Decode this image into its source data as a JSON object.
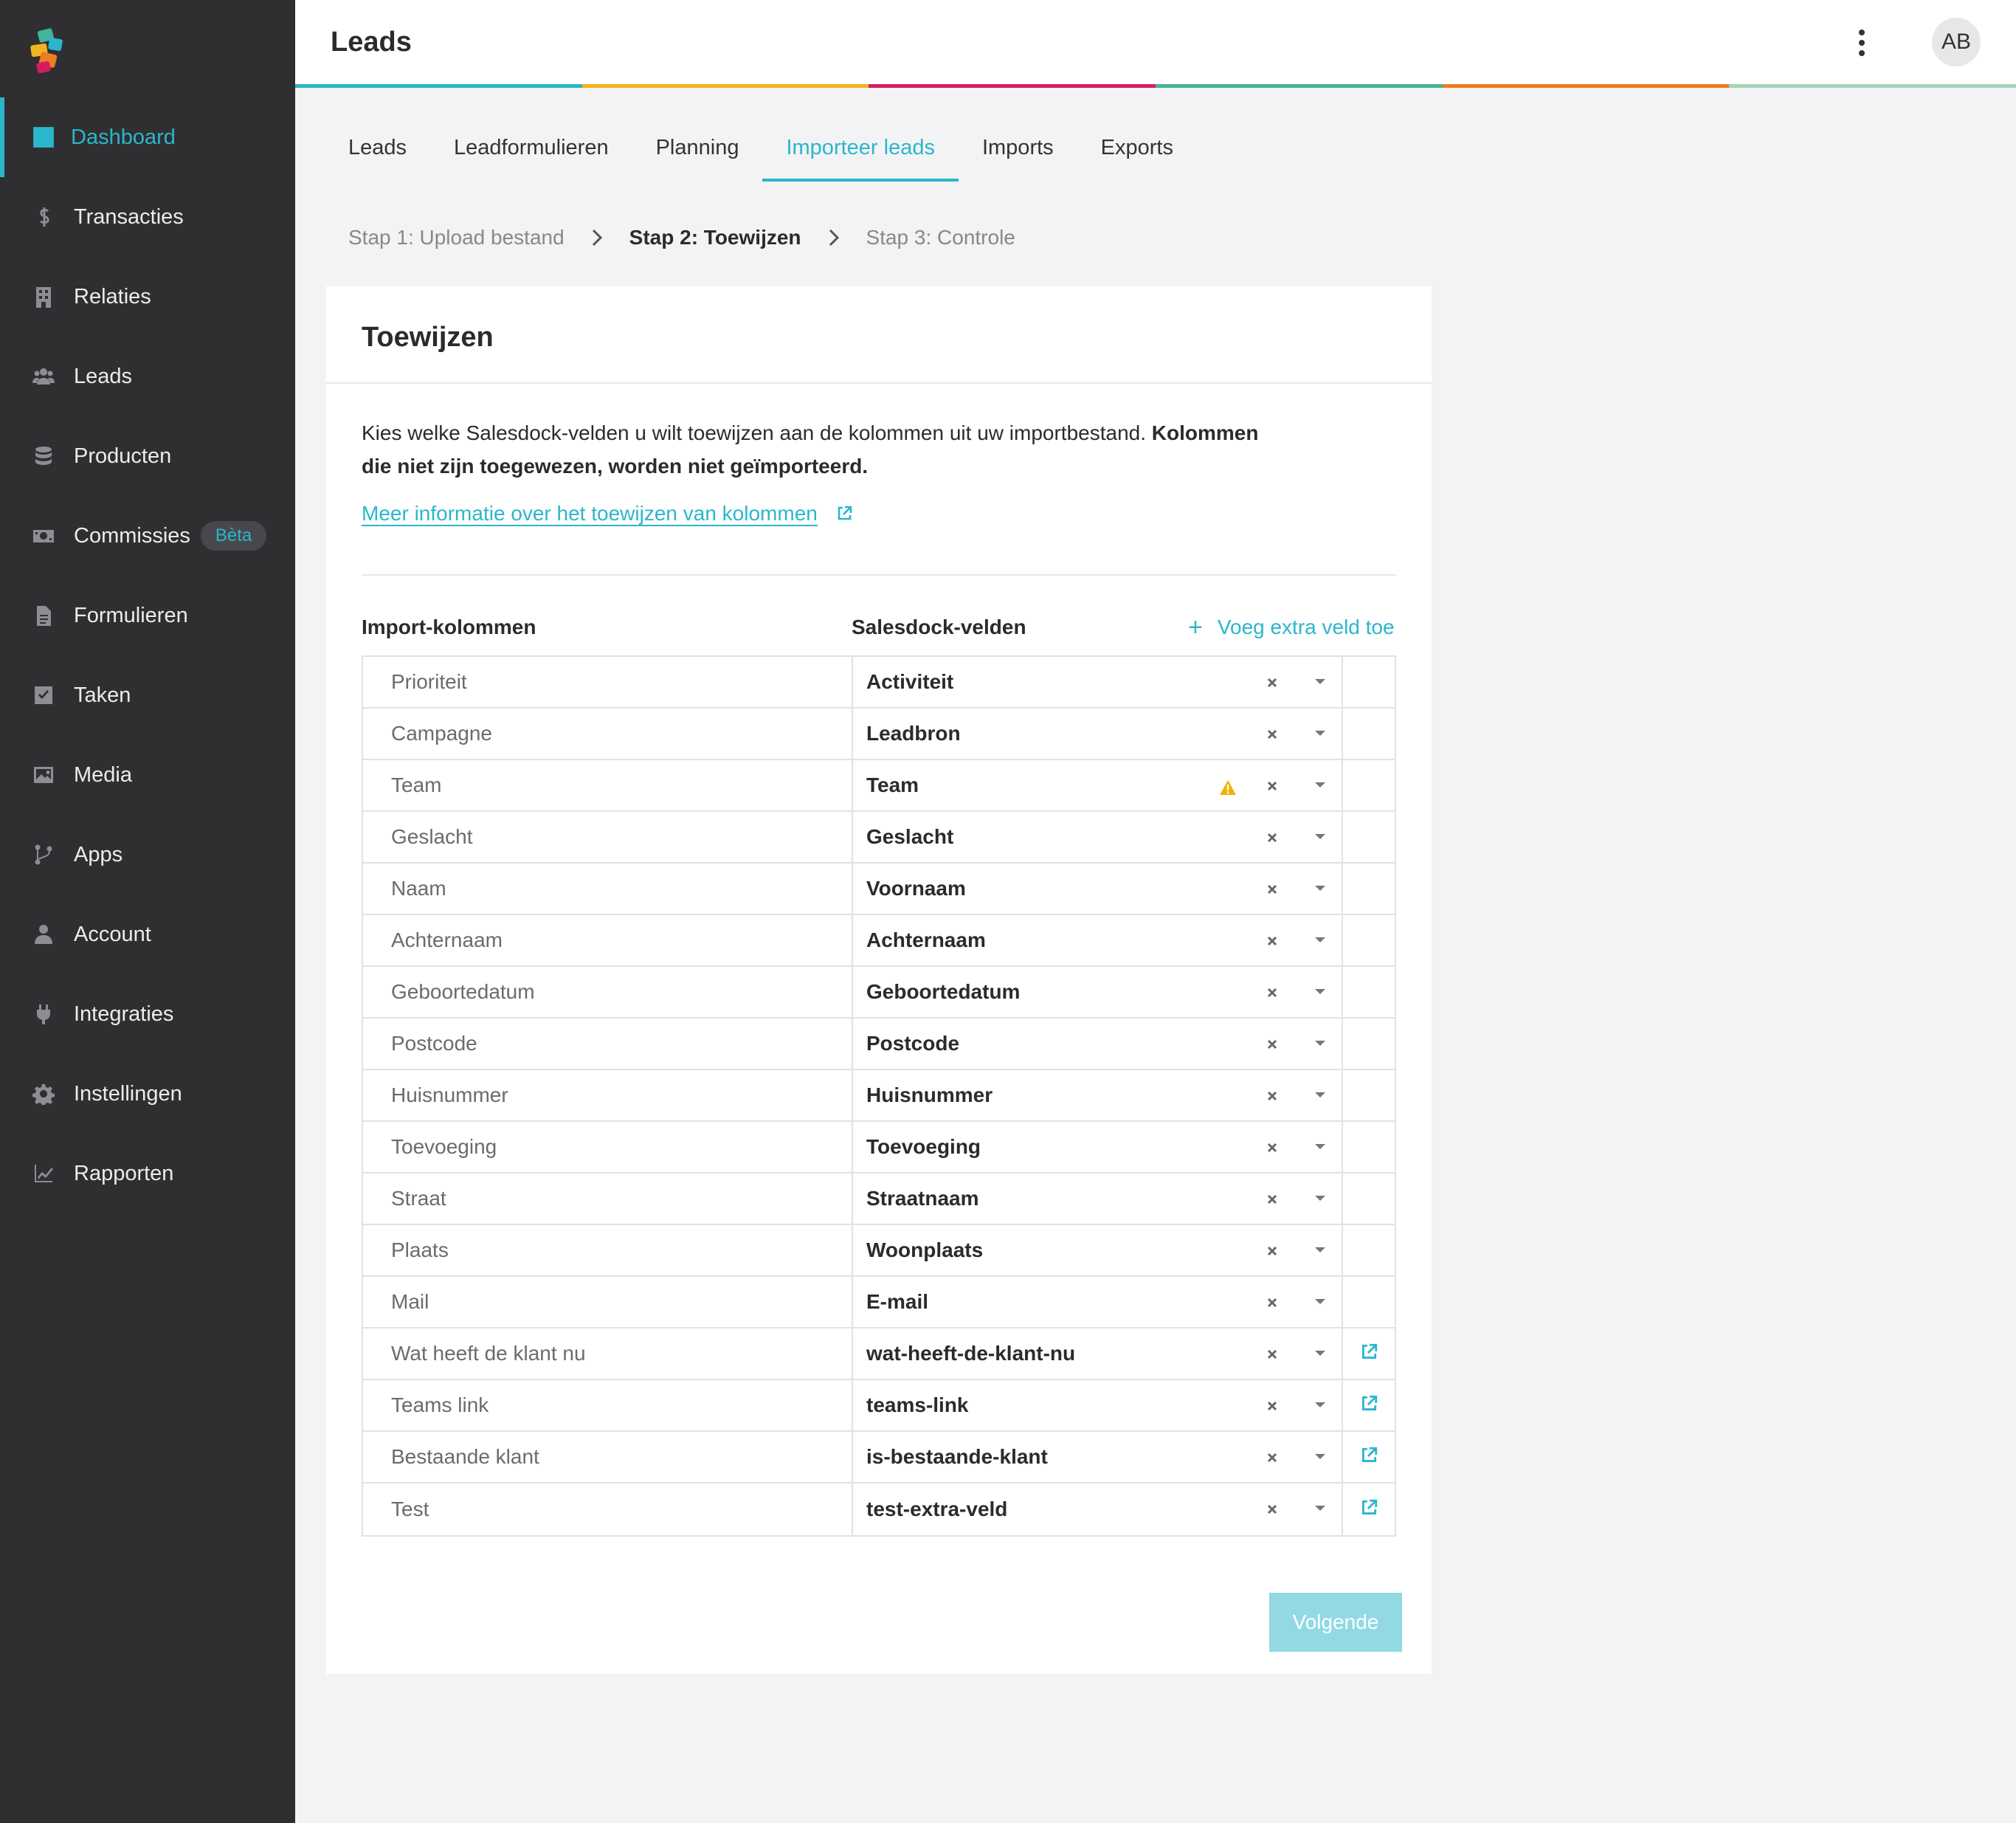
{
  "sidebar": {
    "items": [
      {
        "label": "Dashboard",
        "icon": "dashboard-icon",
        "active": true
      },
      {
        "label": "Transacties",
        "icon": "dollar-icon"
      },
      {
        "label": "Relaties",
        "icon": "building-icon"
      },
      {
        "label": "Leads",
        "icon": "users-icon"
      },
      {
        "label": "Producten",
        "icon": "database-icon"
      },
      {
        "label": "Commissies",
        "icon": "money-icon",
        "badge": "Bèta"
      },
      {
        "label": "Formulieren",
        "icon": "document-icon"
      },
      {
        "label": "Taken",
        "icon": "checkbox-icon"
      },
      {
        "label": "Media",
        "icon": "image-icon"
      },
      {
        "label": "Apps",
        "icon": "branch-icon"
      },
      {
        "label": "Account",
        "icon": "person-icon"
      },
      {
        "label": "Integraties",
        "icon": "plug-icon"
      },
      {
        "label": "Instellingen",
        "icon": "gear-icon"
      },
      {
        "label": "Rapporten",
        "icon": "chart-icon"
      }
    ]
  },
  "header": {
    "title": "Leads",
    "avatar_initials": "AB",
    "stripe_colors": [
      "#2bb6cc",
      "#f2b320",
      "#d81b60",
      "#43b39a",
      "#ee7c22",
      "#a5d4b8"
    ]
  },
  "tabs": [
    {
      "label": "Leads"
    },
    {
      "label": "Leadformulieren"
    },
    {
      "label": "Planning"
    },
    {
      "label": "Importeer leads",
      "active": true
    },
    {
      "label": "Imports"
    },
    {
      "label": "Exports"
    }
  ],
  "stepper": {
    "step1": "Stap 1: Upload bestand",
    "step2": "Stap 2: Toewijzen",
    "step3": "Stap 3: Controle"
  },
  "card": {
    "title": "Toewijzen",
    "description": "Kies welke Salesdock-velden u wilt toewijzen aan de kolommen uit uw importbestand. ",
    "description_bold": "Kolommen die niet zijn toegewezen, worden niet geïmporteerd.",
    "info_link": "Meer informatie over het toewijzen van kolommen",
    "col_import": "Import-kolommen",
    "col_fields": "Salesdock-velden",
    "add_field": "Voeg extra veld toe",
    "next_button": "Volgende"
  },
  "mapping": [
    {
      "import": "Prioriteit",
      "field": "Activiteit"
    },
    {
      "import": "Campagne",
      "field": "Leadbron"
    },
    {
      "import": "Team",
      "field": "Team",
      "warning": true
    },
    {
      "import": "Geslacht",
      "field": "Geslacht"
    },
    {
      "import": "Naam",
      "field": "Voornaam"
    },
    {
      "import": "Achternaam",
      "field": "Achternaam"
    },
    {
      "import": "Geboortedatum",
      "field": "Geboortedatum"
    },
    {
      "import": "Postcode",
      "field": "Postcode"
    },
    {
      "import": "Huisnummer",
      "field": "Huisnummer"
    },
    {
      "import": "Toevoeging",
      "field": "Toevoeging"
    },
    {
      "import": "Straat",
      "field": "Straatnaam"
    },
    {
      "import": "Plaats",
      "field": "Woonplaats"
    },
    {
      "import": "Mail",
      "field": "E-mail"
    },
    {
      "import": "Wat heeft de klant nu",
      "field": "wat-heeft-de-klant-nu",
      "external": true
    },
    {
      "import": "Teams link",
      "field": "teams-link",
      "external": true
    },
    {
      "import": "Bestaande klant",
      "field": "is-bestaande-klant",
      "external": true
    },
    {
      "import": "Test",
      "field": "test-extra-veld",
      "external": true
    }
  ],
  "colors": {
    "accent": "#2bb6cc",
    "sidebar_bg": "#2f2f31",
    "warning": "#f0b400",
    "button_disabled": "#92d9e4"
  }
}
